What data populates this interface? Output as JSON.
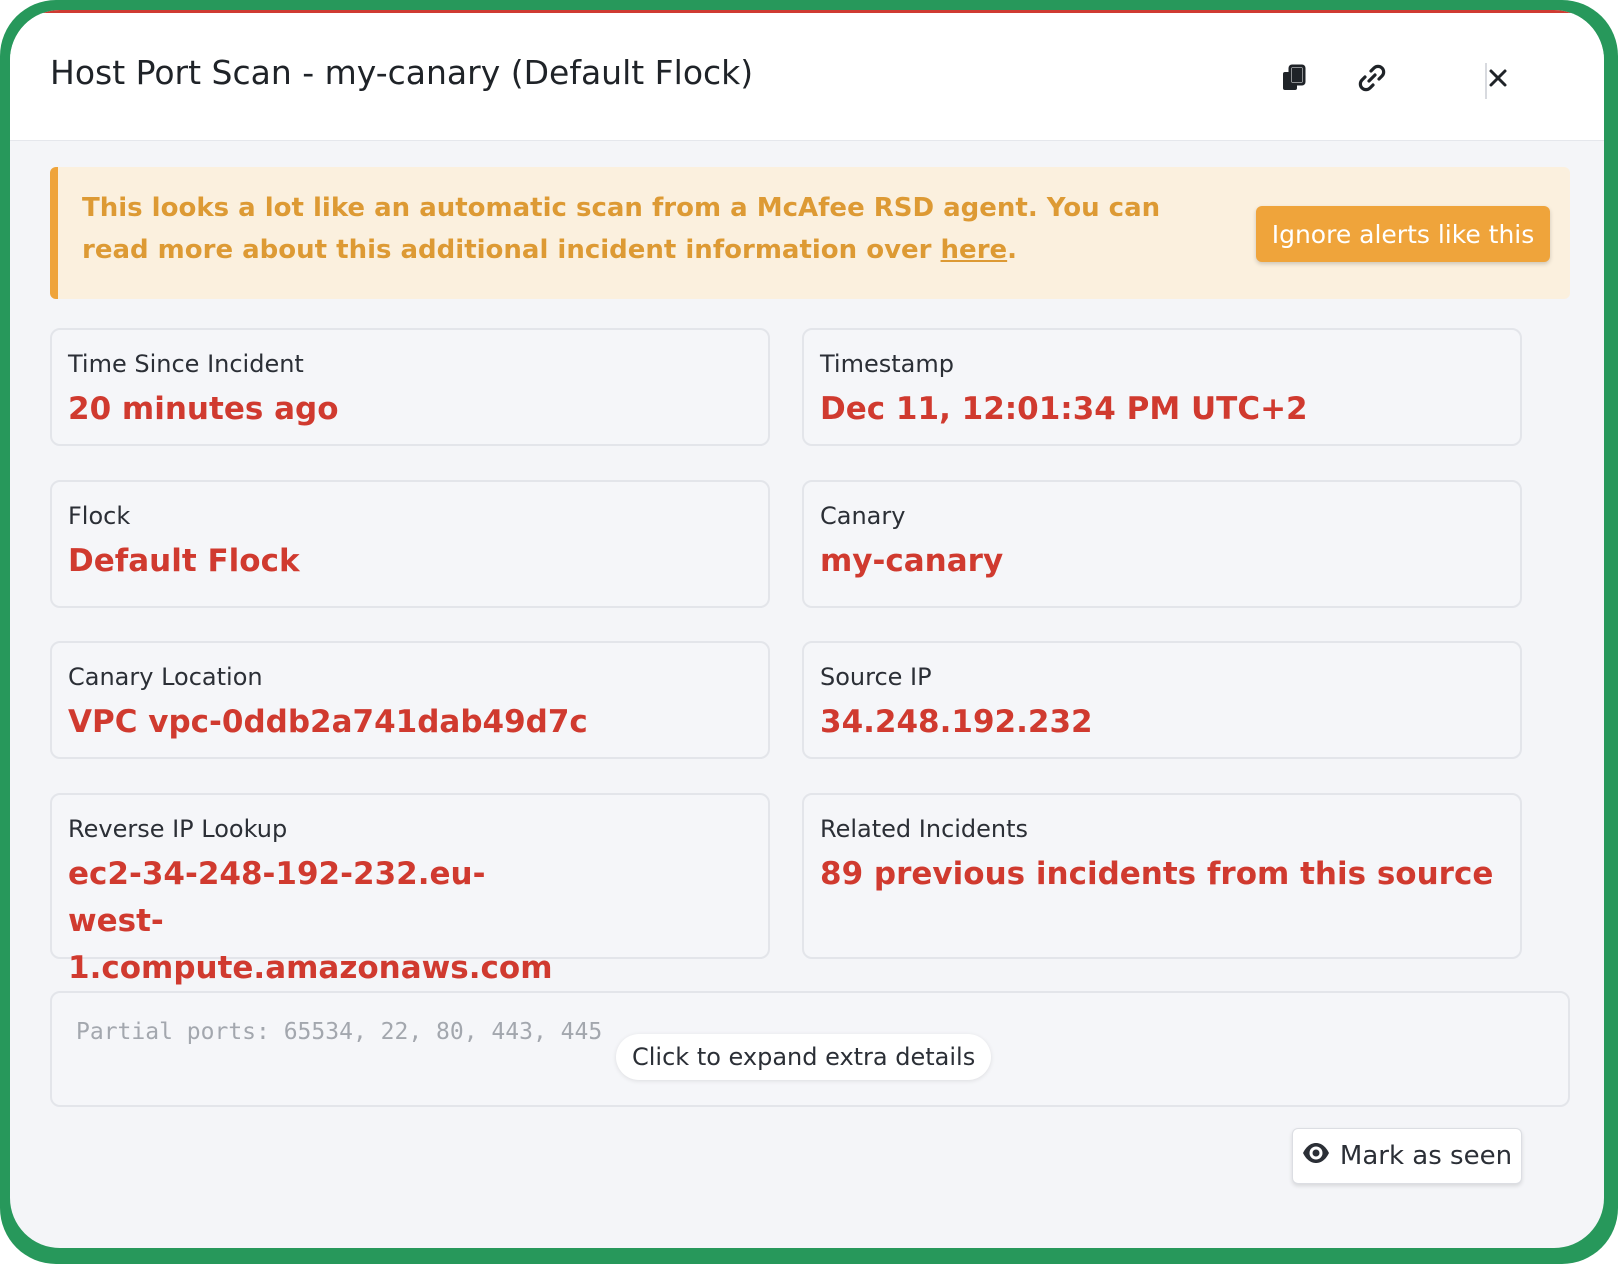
{
  "header": {
    "title": "Host Port Scan - my-canary (Default Flock)",
    "icons": [
      "copy-icon",
      "link-icon",
      "close-icon"
    ]
  },
  "alert": {
    "text_before_link": "This looks a lot like an automatic scan from a McAfee RSD agent. You can read more about this additional incident information over ",
    "link_text": "here",
    "text_after_link": ".",
    "button_label": "Ignore alerts like this"
  },
  "details": [
    {
      "label": "Time Since Incident",
      "value": "20 minutes ago"
    },
    {
      "label": "Timestamp",
      "value": "Dec 11, 12:01:34 PM UTC+2"
    },
    {
      "label": "Flock",
      "value": "Default Flock"
    },
    {
      "label": "Canary",
      "value": "my-canary"
    },
    {
      "label": "Canary Location",
      "value": "VPC vpc-0ddb2a741dab49d7c"
    },
    {
      "label": "Source IP",
      "value": "34.248.192.232"
    },
    {
      "label": "Reverse IP Lookup",
      "value": "ec2-34-248-192-232.eu-west-1.compute.amazonaws.com"
    },
    {
      "label": "Related Incidents",
      "value": "89 previous incidents from this source"
    }
  ],
  "extra": {
    "ports_text": "Partial ports: 65534, 22, 80, 443, 445",
    "expand_label": "Click to expand extra details"
  },
  "footer": {
    "mark_seen_label": "Mark as seen"
  },
  "colors": {
    "frame": "#27985b",
    "accent_red": "#d03a2f",
    "warning_orange": "#efa43b",
    "warning_bg": "#fbf0de"
  }
}
